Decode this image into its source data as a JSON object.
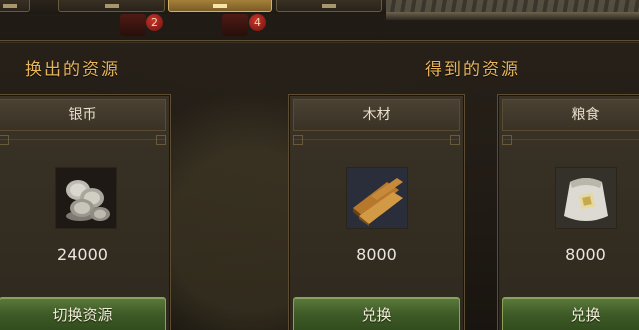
{
  "heading_give": "换出的资源",
  "heading_get": "得到的资源",
  "badges": [
    "2",
    "4"
  ],
  "cards": [
    {
      "title": "银币",
      "icon": "silver-coins-icon",
      "amount": "24000",
      "button": "切换资源"
    },
    {
      "title": "木材",
      "icon": "wood-planks-icon",
      "amount": "8000",
      "button": "兑换"
    },
    {
      "title": "粮食",
      "icon": "grain-sack-icon",
      "amount": "8000",
      "button": "兑换"
    }
  ],
  "colors": {
    "heading": "#e7b35a",
    "button_green": "#3e5a26",
    "tab_active": "#b08a3e",
    "badge_red": "#c9332a"
  }
}
